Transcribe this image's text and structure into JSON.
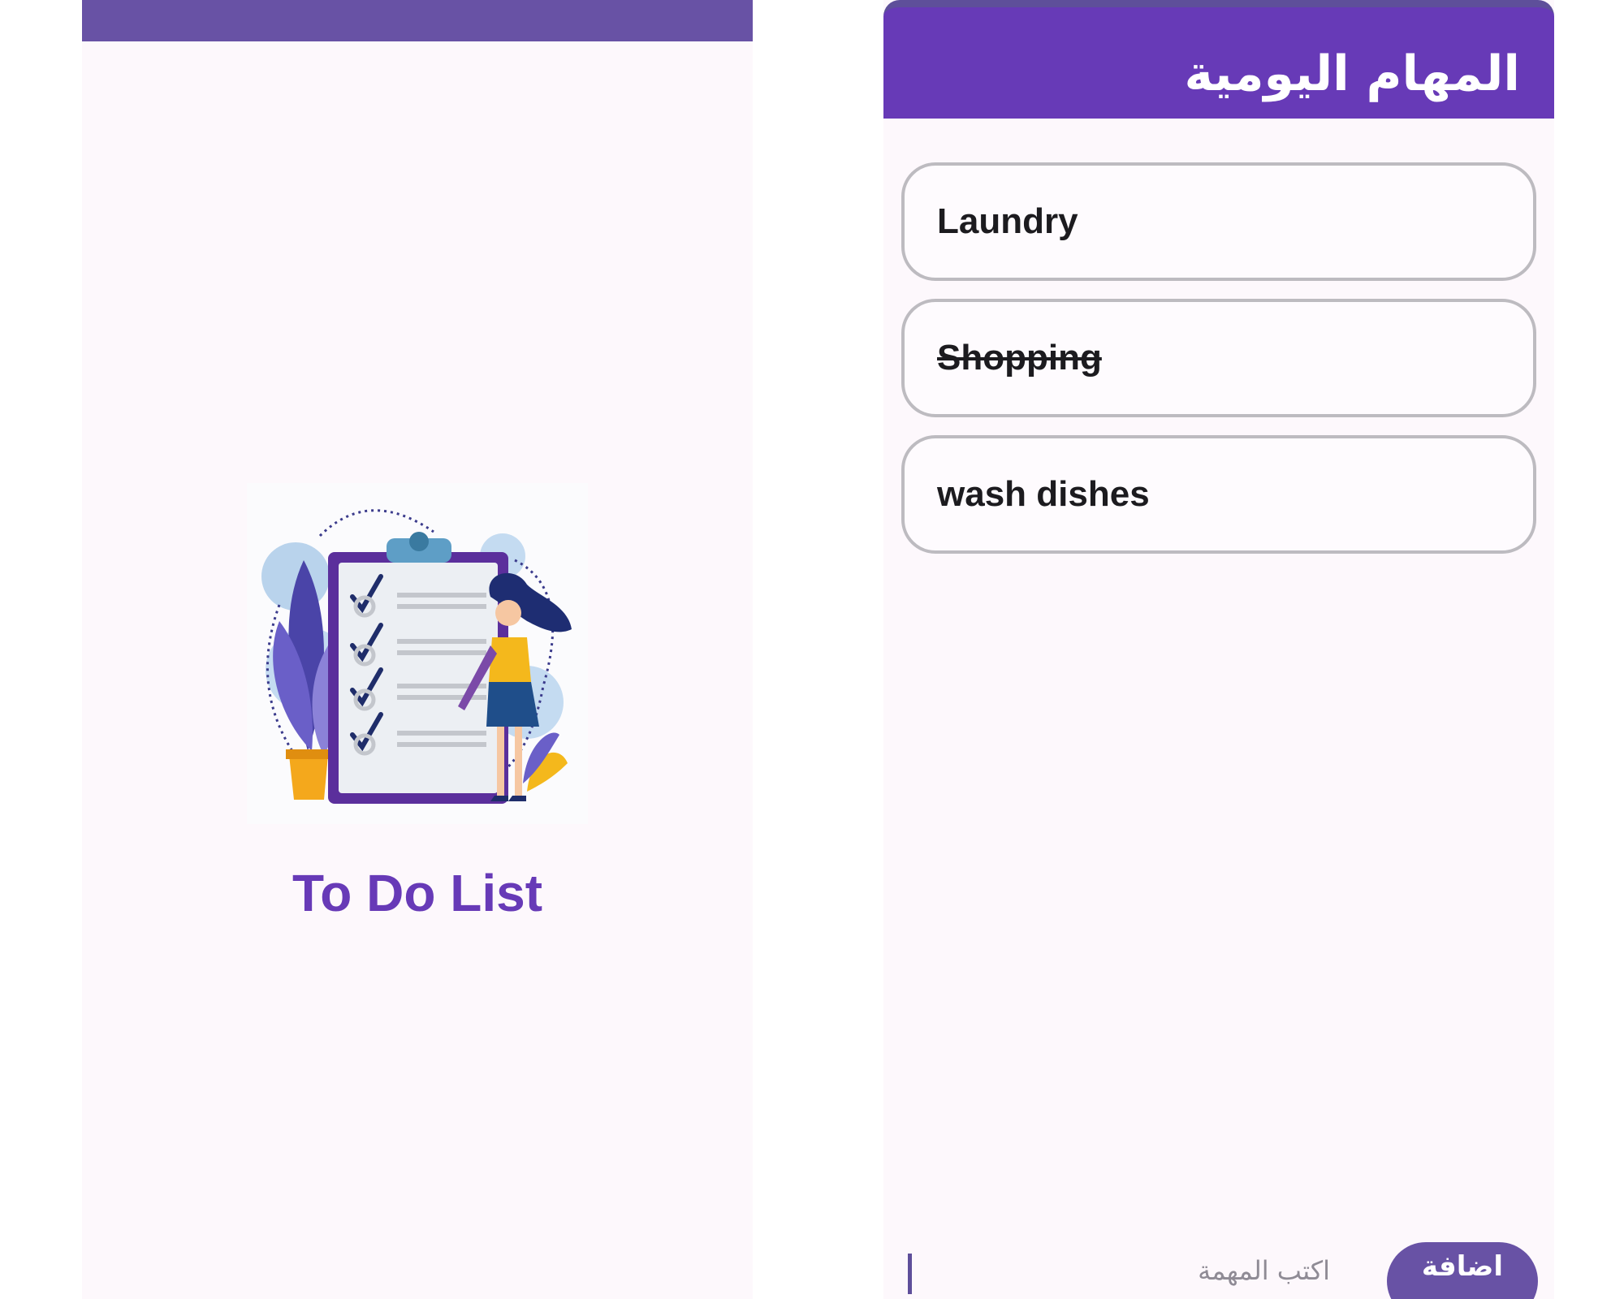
{
  "colors": {
    "primary": "#673ab7",
    "primary_muted": "#6852a5",
    "background": "#fdf8fc",
    "card_border": "#bdbbc0",
    "text": "#1c1b1f"
  },
  "splash": {
    "illustration": "clipboard-checklist-illustration",
    "title": "To Do List"
  },
  "main": {
    "app_bar_title": "المهام اليومية",
    "tasks": [
      {
        "text": "Laundry",
        "completed": false
      },
      {
        "text": "Shopping",
        "completed": true
      },
      {
        "text": "wash dishes",
        "completed": false
      }
    ],
    "input": {
      "value": "",
      "placeholder": "اكتب المهمة"
    },
    "add_button_label": "اضافة"
  }
}
